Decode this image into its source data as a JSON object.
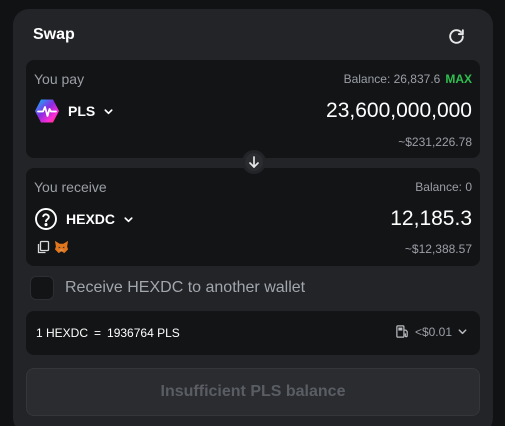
{
  "header": {
    "title": "Swap",
    "refresh_icon": "refresh-icon"
  },
  "pay": {
    "label": "You pay",
    "balance_label": "Balance: 26,837.6",
    "max_label": "MAX",
    "token": "PLS",
    "token_icon": "pulsechain-logo",
    "amount": "23,600,000,000",
    "usd": "~$231,226.78"
  },
  "switch_icon": "arrow-down-icon",
  "receive": {
    "label": "You receive",
    "balance_label": "Balance: 0",
    "token": "HEXDC",
    "token_icon": "question-circle-icon",
    "amount": "12,185.3",
    "usd": "~$12,388.57",
    "tools": [
      "copy-icon",
      "metamask-fox-icon"
    ]
  },
  "another_wallet": {
    "label": "Receive HEXDC to another wallet",
    "checked": false
  },
  "rate": {
    "left": "1 HEXDC",
    "eq": "=",
    "right": "1936764 PLS",
    "gas": "<$0.01",
    "gas_icon": "fuel-pump-icon"
  },
  "cta": {
    "label": "Insufficient PLS balance",
    "disabled": true
  },
  "colors": {
    "background": "#111214",
    "card": "#222427",
    "panel": "#131416",
    "muted": "#9b9fa6",
    "max": "#2fbf4f",
    "disabled_text": "#5a5e64"
  }
}
